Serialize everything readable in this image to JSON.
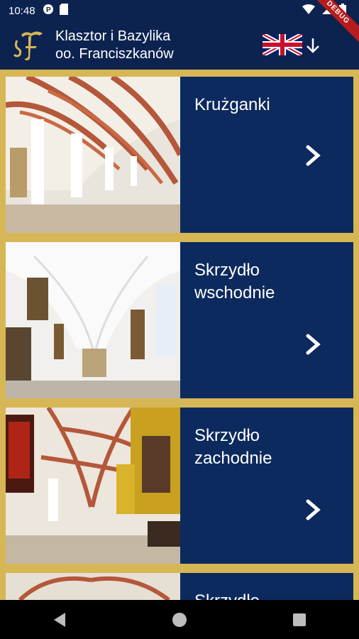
{
  "status_bar": {
    "time": "10:48"
  },
  "debug_label": "DEBUG",
  "app": {
    "title_line1": "Klasztor i Bazylika",
    "title_line2": "oo. Franciszkanów",
    "language_flag": "uk-flag-icon",
    "language_arrow": "arrow-down-icon"
  },
  "sections": [
    {
      "title": "Krużganki",
      "icon": "chevron-right-icon"
    },
    {
      "title": "Skrzydło wschodnie",
      "icon": "chevron-right-icon"
    },
    {
      "title": "Skrzydło zachodnie",
      "icon": "chevron-right-icon"
    },
    {
      "title": "Skrzydło",
      "icon": "chevron-right-icon"
    }
  ],
  "colors": {
    "primary": "#0c2350",
    "panel": "#0c2a5e",
    "gold": "#d7b655"
  }
}
